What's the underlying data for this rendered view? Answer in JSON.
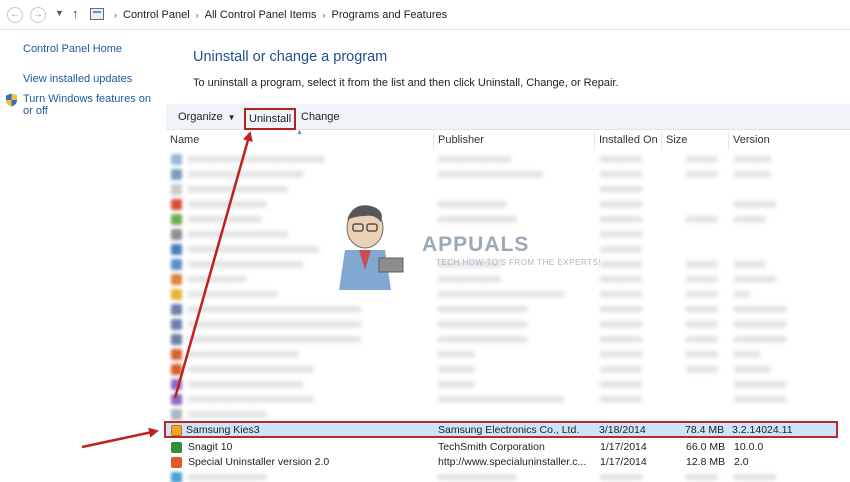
{
  "breadcrumb": [
    "Control Panel",
    "All Control Panel Items",
    "Programs and Features"
  ],
  "sidebar": {
    "home": "Control Panel Home",
    "updates": "View installed updates",
    "features": "Turn Windows features on or off"
  },
  "main": {
    "title": "Uninstall or change a program",
    "description": "To uninstall a program, select it from the list and then click Uninstall, Change, or Repair."
  },
  "toolbar": {
    "organize": "Organize",
    "uninstall": "Uninstall",
    "change": "Change"
  },
  "columns": {
    "name": "Name",
    "publisher": "Publisher",
    "installed_on": "Installed On",
    "size": "Size",
    "version": "Version"
  },
  "selected_program": {
    "name": "Samsung Kies3",
    "publisher": "Samsung Electronics Co., Ltd.",
    "installed_on": "3/18/2014",
    "size": "78.4 MB",
    "version": "3.2.14024.11"
  },
  "programs_after": [
    {
      "name": "Snagit 10",
      "publisher": "TechSmith Corporation",
      "installed_on": "1/17/2014",
      "size": "66.0 MB",
      "version": "10.0.0"
    },
    {
      "name": "Special Uninstaller version 2.0",
      "publisher": "http://www.specialuninstaller.c...",
      "installed_on": "1/17/2014",
      "size": "12.8 MB",
      "version": "2.0"
    }
  ],
  "watermark": {
    "text": "APPUALS",
    "sub": "TECH HOW-TO'S FROM THE EXPERTS!"
  },
  "colors": {
    "accent": "#1e4f8e",
    "highlight_border": "#b52a2a",
    "selected_bg": "#cde3f7"
  }
}
